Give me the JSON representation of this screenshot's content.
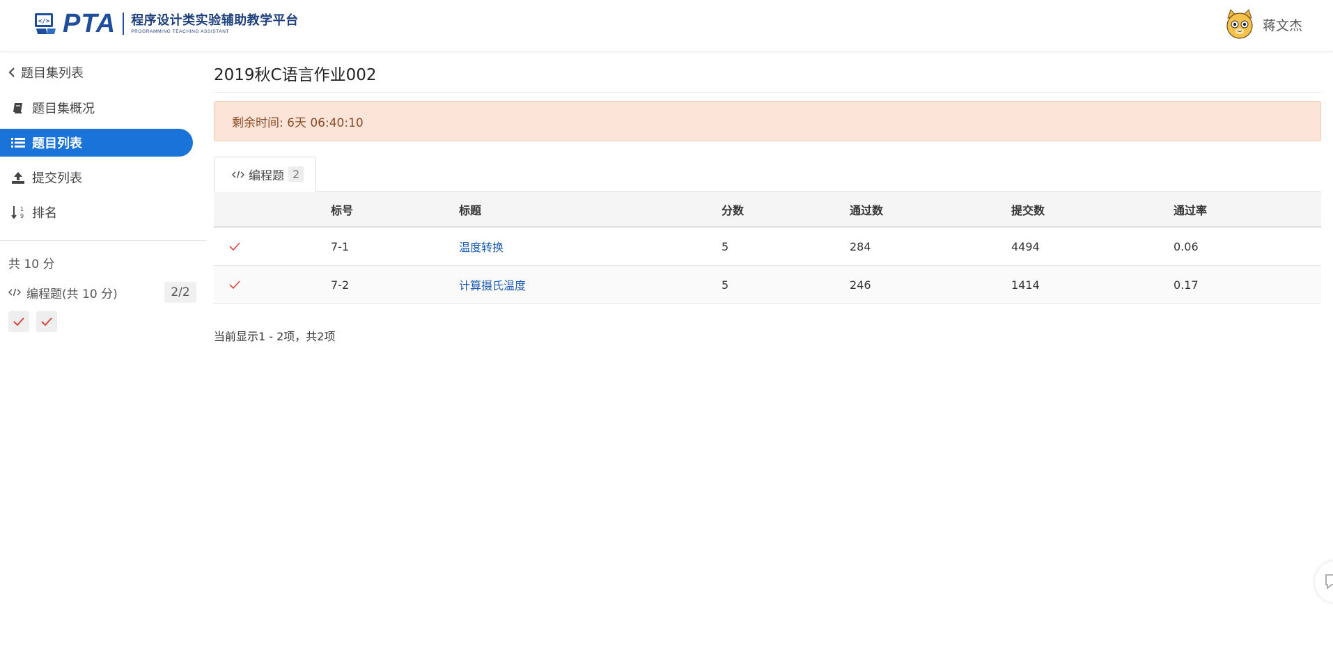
{
  "header": {
    "logo_text": "PTA",
    "platform_name": "程序设计类实验辅助教学平台",
    "platform_name_en": "PROGRAMMING TEACHING ASSISTANT",
    "username": "蒋文杰"
  },
  "sidebar": {
    "back_label": "题目集列表",
    "items": [
      {
        "label": "题目集概况",
        "icon": "book-icon",
        "active": false
      },
      {
        "label": "题目列表",
        "icon": "list-icon",
        "active": true
      },
      {
        "label": "提交列表",
        "icon": "upload-icon",
        "active": false
      },
      {
        "label": "排名",
        "icon": "sort-numeric-icon",
        "active": false
      }
    ],
    "total_score": "共 10 分",
    "programming": {
      "label": "编程题(共 10 分)",
      "count": "2/2",
      "statuses": [
        "passed",
        "passed"
      ]
    }
  },
  "main": {
    "title": "2019秋C语言作业002",
    "remaining_time": "剩余时间: 6天 06:40:10",
    "tab": {
      "label": "编程题",
      "badge": "2"
    },
    "table": {
      "headers": [
        "标号",
        "标题",
        "分数",
        "通过数",
        "提交数",
        "通过率"
      ],
      "rows": [
        {
          "status": "passed",
          "id": "7-1",
          "title": "温度转换",
          "score": "5",
          "passed": "284",
          "submitted": "4494",
          "rate": "0.06"
        },
        {
          "status": "passed",
          "id": "7-2",
          "title": "计算摄氏温度",
          "score": "5",
          "passed": "246",
          "submitted": "1414",
          "rate": "0.17"
        }
      ]
    },
    "pagination_info": "当前显示1 - 2项，共2项"
  },
  "colors": {
    "brand": "#1d4d9c",
    "active_nav": "#1a73d9",
    "timer_bg": "#fce4d8",
    "check_red": "#e0433c",
    "link": "#1c5cb3"
  }
}
